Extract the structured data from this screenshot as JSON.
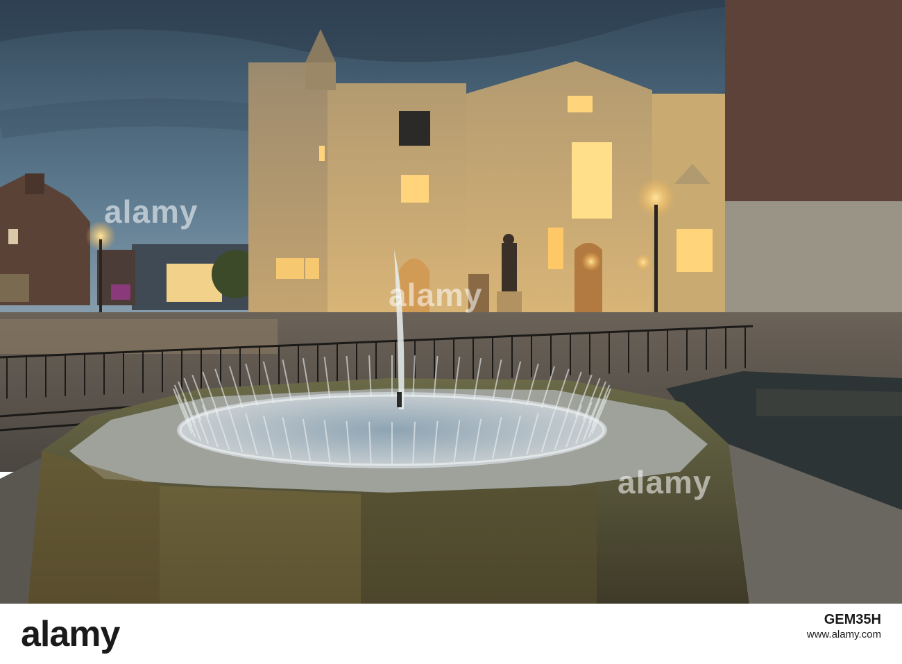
{
  "watermark": {
    "word": "alamy",
    "image_id": "GEM35H",
    "url": "www.alamy.com"
  },
  "colors": {
    "sky": "#4a6478",
    "stone_lit": "#c9a56a",
    "brick": "#5c4238",
    "lamp": "#ffcf6b"
  }
}
